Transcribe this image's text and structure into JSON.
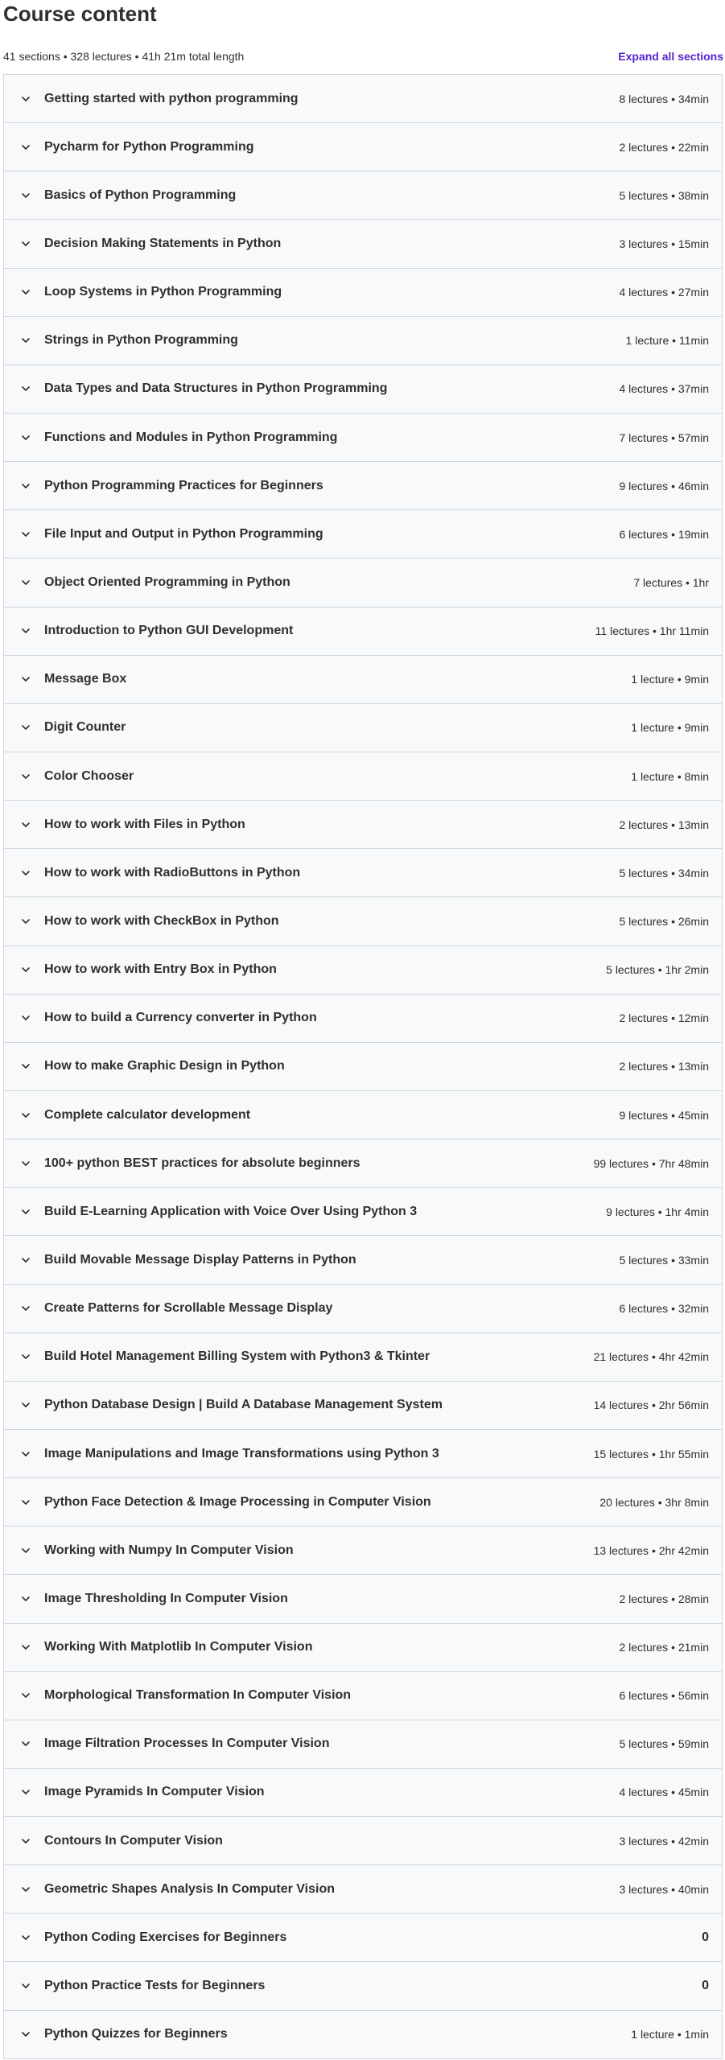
{
  "header": {
    "title": "Course content",
    "summary": "41 sections • 328 lectures • 41h 21m total length",
    "expand_label": "Expand all sections"
  },
  "colors": {
    "accent": "#5624d0",
    "section_bg": "#f7f9fa",
    "border": "#d1d7dc",
    "text": "#2d2f31"
  },
  "sections": [
    {
      "title": "Getting started with python programming",
      "meta": "8 lectures • 34min",
      "icon": "chevron-down-icon"
    },
    {
      "title": "Pycharm for Python Programming",
      "meta": "2 lectures • 22min",
      "icon": "chevron-down-icon"
    },
    {
      "title": "Basics of Python Programming",
      "meta": "5 lectures • 38min",
      "icon": "chevron-down-icon"
    },
    {
      "title": "Decision Making Statements in Python",
      "meta": "3 lectures • 15min",
      "icon": "chevron-down-icon"
    },
    {
      "title": "Loop Systems in Python Programming",
      "meta": "4 lectures • 27min",
      "icon": "chevron-down-icon"
    },
    {
      "title": "Strings in Python Programming",
      "meta": "1 lecture • 11min",
      "icon": "chevron-down-icon"
    },
    {
      "title": "Data Types and Data Structures in Python Programming",
      "meta": "4 lectures • 37min",
      "icon": "chevron-down-icon"
    },
    {
      "title": "Functions and Modules in Python Programming",
      "meta": "7 lectures • 57min",
      "icon": "chevron-down-icon"
    },
    {
      "title": "Python Programming Practices for Beginners",
      "meta": "9 lectures • 46min",
      "icon": "chevron-down-icon"
    },
    {
      "title": "File Input and Output in Python Programming",
      "meta": "6 lectures • 19min",
      "icon": "chevron-down-icon"
    },
    {
      "title": "Object Oriented Programming in Python",
      "meta": "7 lectures • 1hr",
      "icon": "chevron-down-icon"
    },
    {
      "title": "Introduction to Python GUI Development",
      "meta": "11 lectures • 1hr 11min",
      "icon": "chevron-down-icon"
    },
    {
      "title": "Message Box",
      "meta": "1 lecture • 9min",
      "icon": "chevron-down-icon"
    },
    {
      "title": "Digit Counter",
      "meta": "1 lecture • 9min",
      "icon": "chevron-down-icon"
    },
    {
      "title": "Color Chooser",
      "meta": "1 lecture • 8min",
      "icon": "chevron-down-icon"
    },
    {
      "title": "How to work with Files in Python",
      "meta": "2 lectures • 13min",
      "icon": "chevron-down-icon"
    },
    {
      "title": "How to work with RadioButtons in Python",
      "meta": "5 lectures • 34min",
      "icon": "chevron-down-icon"
    },
    {
      "title": "How to work with CheckBox in Python",
      "meta": "5 lectures • 26min",
      "icon": "chevron-down-icon"
    },
    {
      "title": "How to work with Entry Box in Python",
      "meta": "5 lectures • 1hr 2min",
      "icon": "chevron-down-icon"
    },
    {
      "title": "How to build a Currency converter in Python",
      "meta": "2 lectures • 12min",
      "icon": "chevron-down-icon"
    },
    {
      "title": "How to make Graphic Design in Python",
      "meta": "2 lectures • 13min",
      "icon": "chevron-down-icon"
    },
    {
      "title": "Complete calculator development",
      "meta": "9 lectures • 45min",
      "icon": "chevron-down-icon"
    },
    {
      "title": "100+ python BEST practices for absolute beginners",
      "meta": "99 lectures • 7hr 48min",
      "icon": "chevron-down-icon"
    },
    {
      "title": "Build E-Learning Application with Voice Over Using Python 3",
      "meta": "9 lectures • 1hr 4min",
      "icon": "chevron-down-icon"
    },
    {
      "title": "Build Movable Message Display Patterns in Python",
      "meta": "5 lectures • 33min",
      "icon": "chevron-down-icon"
    },
    {
      "title": "Create Patterns for Scrollable Message Display",
      "meta": "6 lectures • 32min",
      "icon": "chevron-down-icon"
    },
    {
      "title": "Build Hotel Management Billing System with Python3 & Tkinter",
      "meta": "21 lectures • 4hr 42min",
      "icon": "chevron-down-icon"
    },
    {
      "title": "Python Database Design | Build A Database Management System",
      "meta": "14 lectures • 2hr 56min",
      "icon": "chevron-down-icon"
    },
    {
      "title": "Image Manipulations and Image Transformations using Python 3",
      "meta": "15 lectures • 1hr 55min",
      "icon": "chevron-down-icon"
    },
    {
      "title": "Python Face Detection & Image Processing in Computer Vision",
      "meta": "20 lectures • 3hr 8min",
      "icon": "chevron-down-icon"
    },
    {
      "title": "Working with Numpy In Computer Vision",
      "meta": "13 lectures • 2hr 42min",
      "icon": "chevron-down-icon"
    },
    {
      "title": "Image Thresholding In Computer Vision",
      "meta": "2 lectures • 28min",
      "icon": "chevron-down-icon"
    },
    {
      "title": "Working With Matplotlib In Computer Vision",
      "meta": "2 lectures • 21min",
      "icon": "chevron-down-icon"
    },
    {
      "title": "Morphological Transformation In Computer Vision",
      "meta": "6 lectures • 56min",
      "icon": "chevron-down-icon"
    },
    {
      "title": "Image Filtration Processes In Computer Vision",
      "meta": "5 lectures • 59min",
      "icon": "chevron-down-icon"
    },
    {
      "title": "Image Pyramids In Computer Vision",
      "meta": "4 lectures • 45min",
      "icon": "chevron-down-icon"
    },
    {
      "title": "Contours In Computer Vision",
      "meta": "3 lectures • 42min",
      "icon": "chevron-down-icon"
    },
    {
      "title": "Geometric Shapes Analysis In Computer Vision",
      "meta": "3 lectures • 40min",
      "icon": "chevron-down-icon"
    },
    {
      "title": "Python Coding Exercises for Beginners",
      "meta": "0",
      "meta_bold": true,
      "icon": "chevron-down-icon"
    },
    {
      "title": "Python Practice Tests for Beginners",
      "meta": "0",
      "meta_bold": true,
      "icon": "chevron-down-icon"
    },
    {
      "title": "Python Quizzes for Beginners",
      "meta": "1 lecture • 1min",
      "icon": "chevron-down-icon"
    }
  ]
}
